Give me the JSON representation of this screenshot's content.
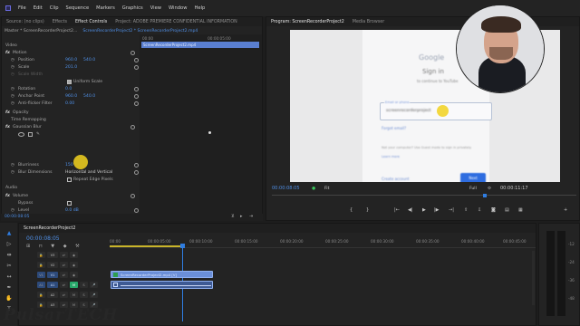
{
  "menubar": {
    "items": [
      "File",
      "Edit",
      "Clip",
      "Sequence",
      "Markers",
      "Graphics",
      "View",
      "Window",
      "Help"
    ]
  },
  "source_panel": {
    "tabs": [
      "Source: (no clips)",
      "Effects",
      "Effect Controls",
      "Project: ADOBE PREMIERE CONFIDENTIAL INFORMATION"
    ],
    "master_label": "Master * ScreenRecorderProject2...",
    "sequence_label": "ScreenRecorderProject2 * ScreenRecorderProject2.mp4",
    "mini_timecode": "00:00",
    "mini_timecode2": "00:00:05:00",
    "clip_name": "ScreenRecorderProject2.mp4",
    "section_video": "Video",
    "motion": {
      "label": "Motion",
      "position_label": "Position",
      "position_x": "960.0",
      "position_y": "540.0",
      "scale_label": "Scale",
      "scale_val": "201.0",
      "scale_width_label": "Scale Width",
      "uniform_label": "Uniform Scale",
      "rotation_label": "Rotation",
      "rotation_val": "0.0",
      "anchor_label": "Anchor Point",
      "anchor_x": "960.0",
      "anchor_y": "540.0",
      "antiflicker_label": "Anti-flicker Filter",
      "antiflicker_val": "0.00"
    },
    "opacity_label": "Opacity",
    "time_remap_label": "Time Remapping",
    "gaussian": {
      "label": "Gaussian Blur",
      "blurriness_label": "Blurriness",
      "blurriness_val": "150",
      "dimensions_label": "Blur Dimensions",
      "dimensions_val": "Horizontal and Vertical",
      "repeat_label": "Repeat Edge Pixels"
    },
    "section_audio": "Audio",
    "volume": {
      "label": "Volume",
      "bypass_label": "Bypass",
      "level_label": "Level",
      "level_val": "0.0 dB"
    },
    "channel_volume_label": "Channel Volume",
    "panner_label": "Panner",
    "bottom_timecode": "00:00:08:05"
  },
  "program_panel": {
    "tabs": [
      "Program: ScreenRecorderProject2",
      "Media Browser"
    ],
    "timecode": "00:00:08:05",
    "fit_label": "Fit",
    "quality_label": "Full",
    "duration": "00:00:11:17",
    "page": {
      "logo": "Google",
      "title": "Sign in",
      "subtitle": "to continue to YouTube",
      "email_label": "Email or phone",
      "email_value": "screenrecorderproject",
      "forgot_label": "Forgot email?",
      "guest_text": "Not your computer? Use Guest mode to sign in privately.",
      "learn_more": "Learn more",
      "create_label": "Create account",
      "next_label": "Next"
    },
    "transport": [
      "{",
      "}",
      "|←",
      "◀|",
      "▶",
      "|▶",
      "→|",
      "…"
    ]
  },
  "timeline": {
    "tab": "ScreenRecorderProject2",
    "timecode": "00:00:08:05",
    "ruler": [
      "00:00",
      "00:00:05:00",
      "00:00:10:00",
      "00:00:15:00",
      "00:00:20:00",
      "00:00:25:00",
      "00:00:30:00",
      "00:00:35:00",
      "00:00:40:00",
      "00:00:45:00"
    ],
    "tracks": [
      "V3",
      "V2",
      "V1",
      "A1",
      "A2",
      "A3"
    ],
    "video_clip_label": "ScreenRecorderProject2.mp4 [V]",
    "audio_meter_labels": [
      "-12",
      "-24",
      "-36",
      "-48"
    ]
  },
  "watermark": "PulsarTECH",
  "colors": {
    "accent_blue": "#4f8fe6",
    "clip_video": "#6b8fd8",
    "playhead": "#2f7de1",
    "highlight": "#f2d21e"
  }
}
